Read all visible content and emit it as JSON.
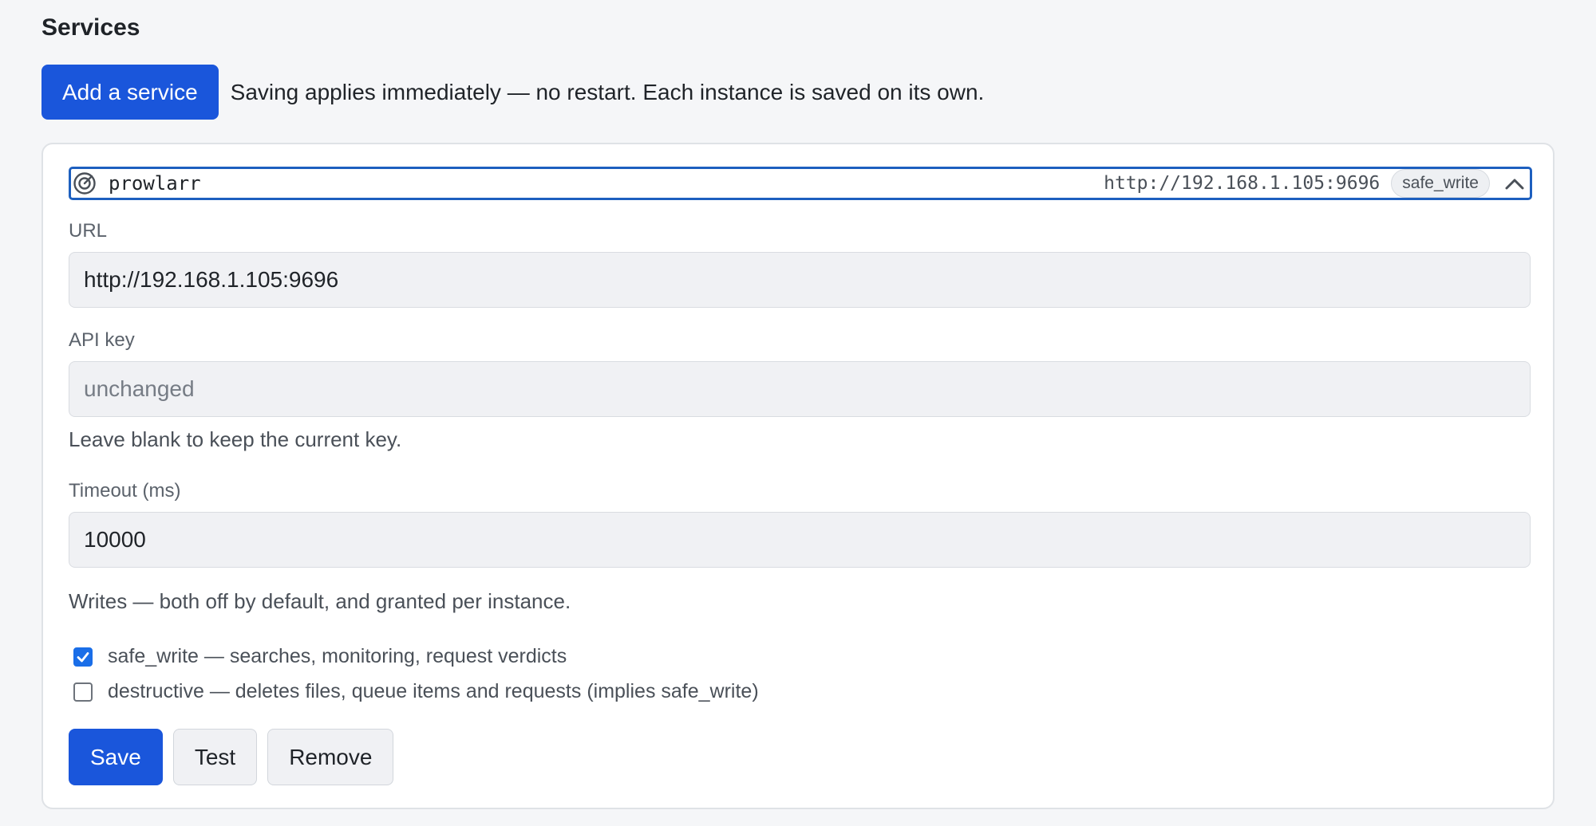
{
  "section": {
    "title": "Services",
    "add_button": "Add a service",
    "note": "Saving applies immediately — no restart. Each instance is saved on its own."
  },
  "service": {
    "icon": "radar-icon",
    "name": "prowlarr",
    "url": "http://192.168.1.105:9696",
    "badge": "safe_write",
    "expanded": true,
    "toggle_icon": "chevron-up-icon"
  },
  "form": {
    "url_label": "URL",
    "url_value": "http://192.168.1.105:9696",
    "api_key_label": "API key",
    "api_key_value": "",
    "api_key_placeholder": "unchanged",
    "api_key_hint": "Leave blank to keep the current key.",
    "timeout_label": "Timeout (ms)",
    "timeout_value": "10000",
    "writes_note": "Writes — both off by default, and granted per instance.",
    "checkboxes": [
      {
        "label": "safe_write — searches, monitoring, request verdicts",
        "checked": true
      },
      {
        "label": "destructive — deletes files, queue items and requests (implies safe_write)",
        "checked": false
      }
    ]
  },
  "actions": {
    "save": "Save",
    "test": "Test",
    "remove": "Remove"
  },
  "colors": {
    "accent": "#1a56db",
    "focus_border": "#1d5fbf",
    "page_bg": "#f5f6f8",
    "checkbox_checked": "#1a6ee8"
  }
}
